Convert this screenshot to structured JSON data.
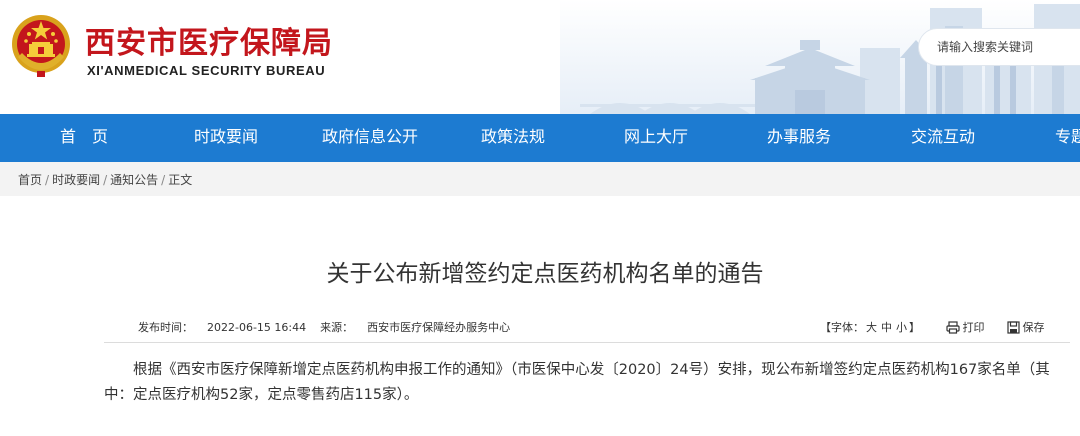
{
  "header": {
    "title": "西安市医疗保障局",
    "subtitle": "XI'ANMEDICAL SECURITY BUREAU",
    "emblem_icon": "national-emblem-icon",
    "search_placeholder": "请输入搜索关键词"
  },
  "nav": {
    "items": [
      {
        "label": "首　页"
      },
      {
        "label": "时政要闻"
      },
      {
        "label": "政府信息公开"
      },
      {
        "label": "政策法规"
      },
      {
        "label": "网上大厅"
      },
      {
        "label": "办事服务"
      },
      {
        "label": "交流互动"
      },
      {
        "label": "专题"
      }
    ]
  },
  "breadcrumb": {
    "items": [
      "首页",
      "时政要闻",
      "通知公告",
      "正文"
    ],
    "separator": "/"
  },
  "article": {
    "title": "关于公布新增签约定点医药机构名单的通告",
    "publish_label": "发布时间：",
    "publish_time": "2022-06-15 16:44",
    "source_label": "来源：",
    "source": "西安市医疗保障经办服务中心",
    "font_size_label": "【字体：",
    "font_large": "大",
    "font_medium": "中",
    "font_small": "小",
    "font_size_close": "】",
    "print_label": "打印",
    "save_label": "保存",
    "body": "根据《西安市医疗保障新增定点医药机构申报工作的通知》（市医保中心发〔2020〕24号）安排，现公布新增签约定点医药机构167家名单（其中：定点医疗机构52家，定点零售药店115家）。"
  },
  "colors": {
    "brand_red": "#c3161c",
    "nav_blue": "#1d7bd1",
    "breadcrumb_bg": "#f3f3f3"
  }
}
